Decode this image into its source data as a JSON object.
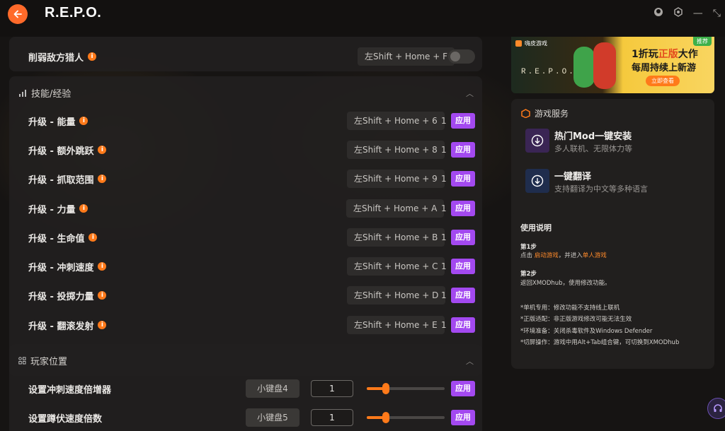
{
  "app": {
    "title": "R.E.P.O."
  },
  "top_card": {
    "label": "削弱敌方猎人",
    "hotkey": "左Shift + Home + F"
  },
  "skills_section": {
    "title": "技能/经验",
    "rows": [
      {
        "label": "升级 - 能量",
        "hotkey": "左Shift + Home + 6",
        "count": "1",
        "apply": "应用"
      },
      {
        "label": "升级 - 额外跳跃",
        "hotkey": "左Shift + Home + 8",
        "count": "1",
        "apply": "应用"
      },
      {
        "label": "升级 - 抓取范围",
        "hotkey": "左Shift + Home + 9",
        "count": "1",
        "apply": "应用"
      },
      {
        "label": "升级 - 力量",
        "hotkey": "左Shift + Home + A",
        "count": "1",
        "apply": "应用"
      },
      {
        "label": "升级 - 生命值",
        "hotkey": "左Shift + Home + B",
        "count": "1",
        "apply": "应用"
      },
      {
        "label": "升级 - 冲刺速度",
        "hotkey": "左Shift + Home + C",
        "count": "1",
        "apply": "应用"
      },
      {
        "label": "升级 - 投掷力量",
        "hotkey": "左Shift + Home + D",
        "count": "1",
        "apply": "应用"
      },
      {
        "label": "升级 - 翻滚发射",
        "hotkey": "左Shift + Home + E",
        "count": "1",
        "apply": "应用"
      }
    ]
  },
  "player_section": {
    "title": "玩家位置",
    "rows": [
      {
        "label": "设置冲刺速度倍增器",
        "key": "小键盘4",
        "value": "1",
        "apply": "应用",
        "slider_level": 0.26
      },
      {
        "label": "设置蹲伏速度倍数",
        "key": "小键盘5",
        "value": "1",
        "apply": "应用",
        "slider_level": 0.26
      }
    ]
  },
  "banner": {
    "brand": "嗨皮游戏",
    "tag": "推荐",
    "game": "R.E.P.O.",
    "line1_prefix": "1折玩",
    "line1_highlight": "正版",
    "line1_suffix": "大作",
    "line2": "每周持续上新游",
    "cta": "立即查看"
  },
  "services": {
    "title": "游戏服务",
    "items": [
      {
        "name": "热门Mod一键安装",
        "desc": "多人联机、无限体力等"
      },
      {
        "name": "一键翻译",
        "desc": "支持翻译为中文等多种语言"
      }
    ]
  },
  "help": {
    "title": "使用说明",
    "step1_title": "第1步",
    "step1_a": "点击 ",
    "step1_link1": "启动游戏",
    "step1_b": "，并进入",
    "step1_link2": "单人游戏",
    "step2_title": "第2步",
    "step2_text": "返回XMODhub，使用修改功能。",
    "note1": "*单机专用：修改功能不支持线上联机",
    "note2": "*正版适配：非正版游戏修改可能无法生效",
    "note3": "*环境准备：关闭杀毒软件及Windows Defender",
    "note4": "*切屏操作：游戏中用Alt+Tab组合键，可切换到XMODhub"
  },
  "colors": {
    "accent": "#ff7a1a",
    "apply": "#a349f0",
    "back": "#ff6a2a"
  }
}
